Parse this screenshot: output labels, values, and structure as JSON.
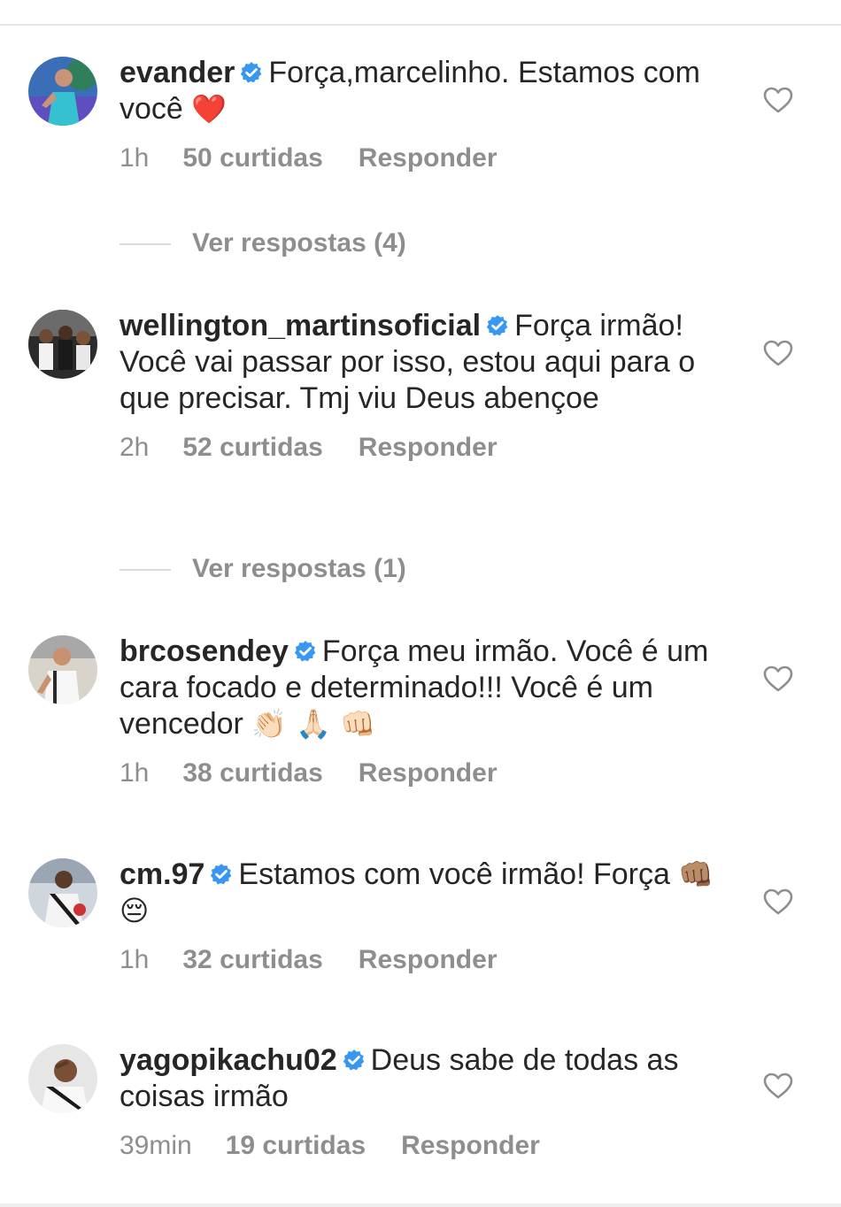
{
  "colors": {
    "verified": "#3897f0",
    "muted": "#8e8e8e",
    "text": "#262626",
    "heart_emoji": "#e0245e"
  },
  "comments": [
    {
      "username": "evander",
      "text": "Força,marcelinho. Estamos com você",
      "emoji": "❤️",
      "time": "1h",
      "likes": "50 curtidas",
      "reply": "Responder",
      "view_replies": "Ver respostas (4)"
    },
    {
      "username": "wellington_martinsoficial",
      "text": "Força irmão! Você vai passar por isso, estou aqui para o que precisar. Tmj viu Deus abençoe",
      "emoji": "",
      "time": "2h",
      "likes": "52 curtidas",
      "reply": "Responder",
      "view_replies": "Ver respostas (1)"
    },
    {
      "username": "brcosendey",
      "text": "Força meu irmão. Você é um cara focado e determinado!!! Você é um vencedor",
      "emoji": "👏🏻 🙏🏻 👊🏻",
      "time": "1h",
      "likes": "38 curtidas",
      "reply": "Responder"
    },
    {
      "username": "cm.97",
      "text": "Estamos com você irmão! Força",
      "emoji": "👊🏽 😔",
      "time": "1h",
      "likes": "32 curtidas",
      "reply": "Responder"
    },
    {
      "username": "yagopikachu02",
      "text": "Deus sabe de todas as coisas irmão",
      "emoji": "",
      "time": "39min",
      "likes": "19 curtidas",
      "reply": "Responder"
    }
  ],
  "icons": {
    "verified": "verified-badge-icon",
    "like": "heart-outline-icon"
  }
}
